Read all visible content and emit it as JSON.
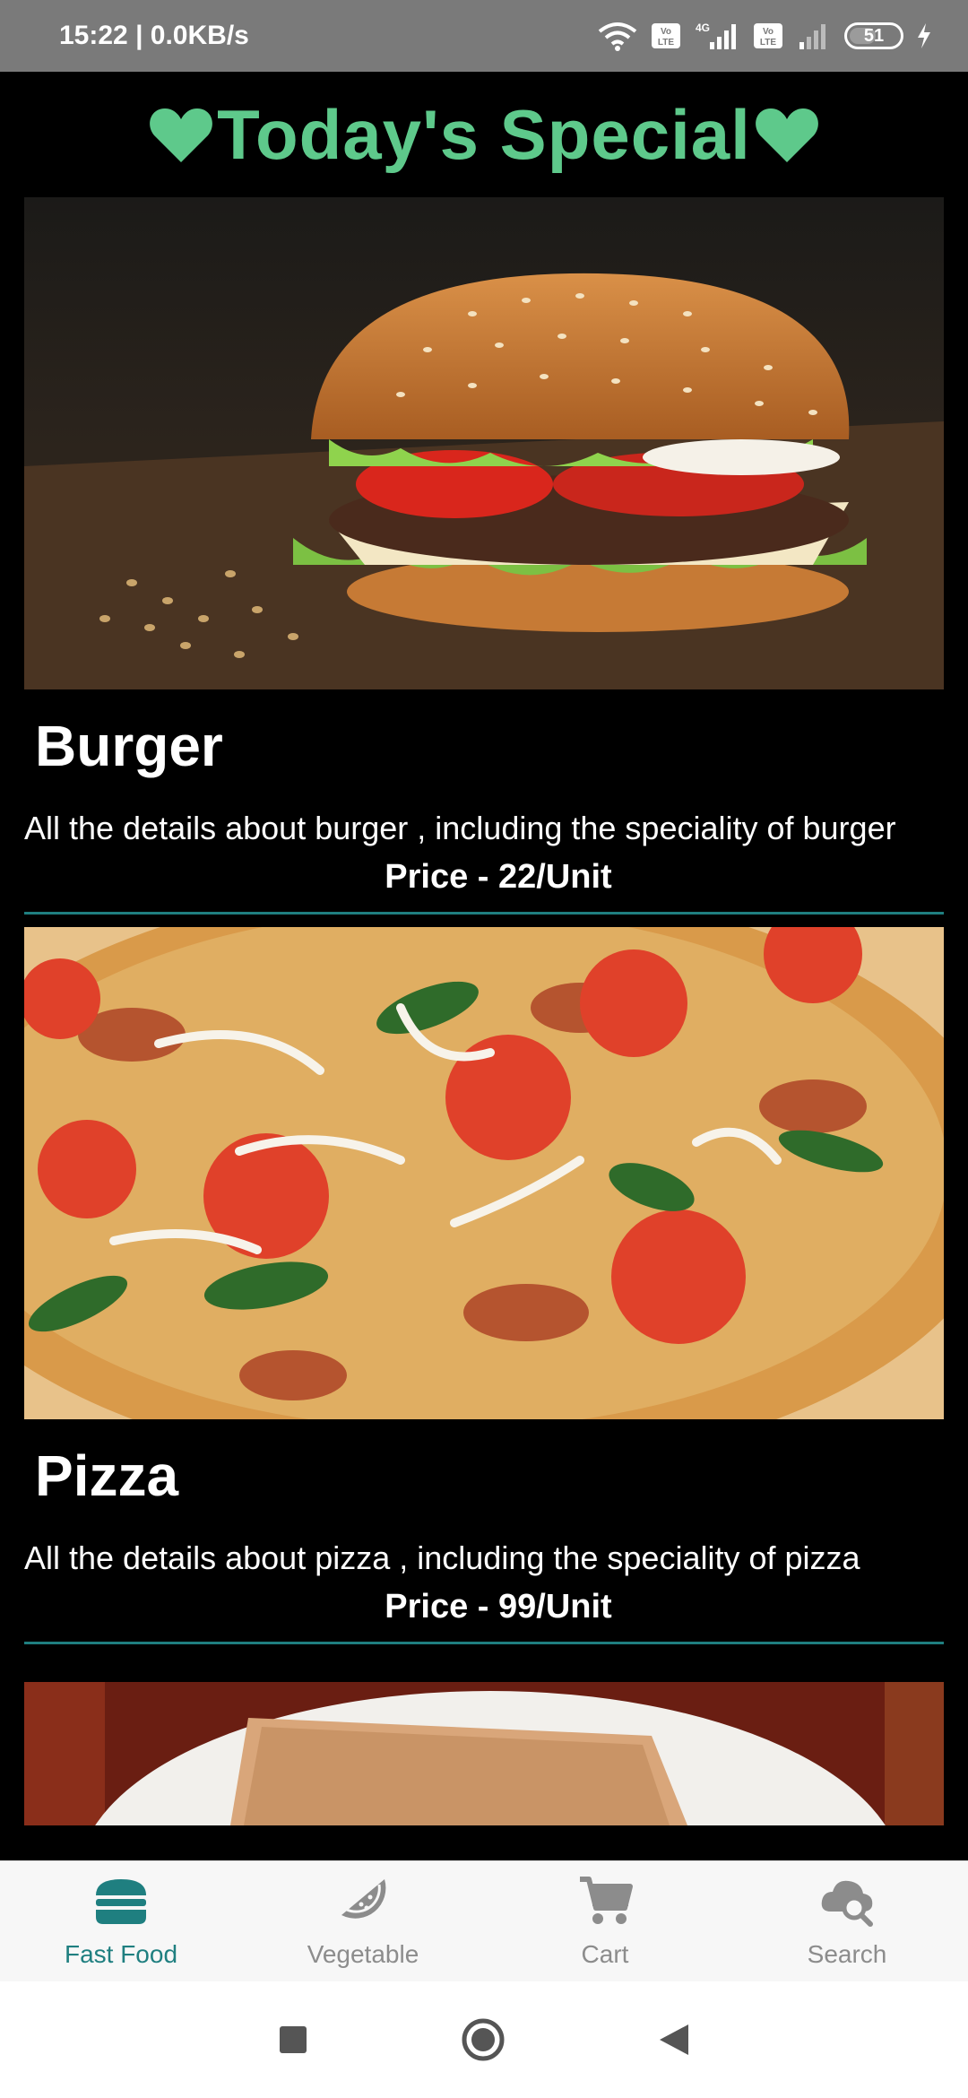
{
  "status_bar": {
    "time_speed": "15:22 | 0.0KB/s",
    "battery": "51"
  },
  "header": {
    "title": "Today's Special"
  },
  "items": [
    {
      "name": "Burger",
      "description": "All the details about burger , including the speciality of burger",
      "price": "Price - 22/Unit"
    },
    {
      "name": "Pizza",
      "description": "All the details about pizza , including the speciality of pizza",
      "price": "Price - 99/Unit"
    }
  ],
  "bottom_nav": {
    "items": [
      {
        "label": "Fast Food",
        "icon": "burger-icon"
      },
      {
        "label": "Vegetable",
        "icon": "watermelon-icon"
      },
      {
        "label": "Cart",
        "icon": "cart-icon"
      },
      {
        "label": "Search",
        "icon": "cloud-search-icon"
      }
    ]
  },
  "colors": {
    "accent": "#5ec98b",
    "nav_active": "#1f7f80",
    "nav_inactive": "#8c8c8c"
  }
}
